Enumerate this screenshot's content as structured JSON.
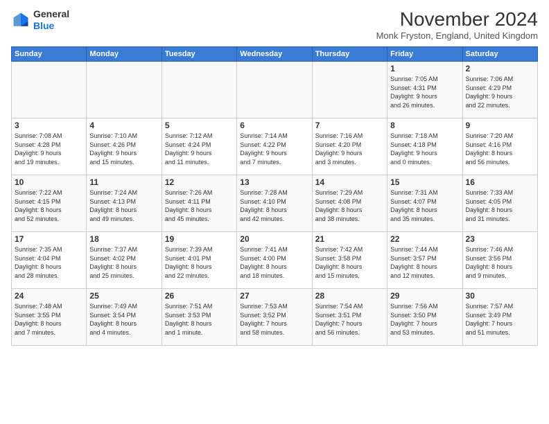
{
  "header": {
    "logo_line1": "General",
    "logo_line2": "Blue",
    "month_title": "November 2024",
    "location": "Monk Fryston, England, United Kingdom"
  },
  "weekdays": [
    "Sunday",
    "Monday",
    "Tuesday",
    "Wednesday",
    "Thursday",
    "Friday",
    "Saturday"
  ],
  "weeks": [
    [
      {
        "day": "",
        "info": ""
      },
      {
        "day": "",
        "info": ""
      },
      {
        "day": "",
        "info": ""
      },
      {
        "day": "",
        "info": ""
      },
      {
        "day": "",
        "info": ""
      },
      {
        "day": "1",
        "info": "Sunrise: 7:05 AM\nSunset: 4:31 PM\nDaylight: 9 hours\nand 26 minutes."
      },
      {
        "day": "2",
        "info": "Sunrise: 7:06 AM\nSunset: 4:29 PM\nDaylight: 9 hours\nand 22 minutes."
      }
    ],
    [
      {
        "day": "3",
        "info": "Sunrise: 7:08 AM\nSunset: 4:28 PM\nDaylight: 9 hours\nand 19 minutes."
      },
      {
        "day": "4",
        "info": "Sunrise: 7:10 AM\nSunset: 4:26 PM\nDaylight: 9 hours\nand 15 minutes."
      },
      {
        "day": "5",
        "info": "Sunrise: 7:12 AM\nSunset: 4:24 PM\nDaylight: 9 hours\nand 11 minutes."
      },
      {
        "day": "6",
        "info": "Sunrise: 7:14 AM\nSunset: 4:22 PM\nDaylight: 9 hours\nand 7 minutes."
      },
      {
        "day": "7",
        "info": "Sunrise: 7:16 AM\nSunset: 4:20 PM\nDaylight: 9 hours\nand 3 minutes."
      },
      {
        "day": "8",
        "info": "Sunrise: 7:18 AM\nSunset: 4:18 PM\nDaylight: 9 hours\nand 0 minutes."
      },
      {
        "day": "9",
        "info": "Sunrise: 7:20 AM\nSunset: 4:16 PM\nDaylight: 8 hours\nand 56 minutes."
      }
    ],
    [
      {
        "day": "10",
        "info": "Sunrise: 7:22 AM\nSunset: 4:15 PM\nDaylight: 8 hours\nand 52 minutes."
      },
      {
        "day": "11",
        "info": "Sunrise: 7:24 AM\nSunset: 4:13 PM\nDaylight: 8 hours\nand 49 minutes."
      },
      {
        "day": "12",
        "info": "Sunrise: 7:26 AM\nSunset: 4:11 PM\nDaylight: 8 hours\nand 45 minutes."
      },
      {
        "day": "13",
        "info": "Sunrise: 7:28 AM\nSunset: 4:10 PM\nDaylight: 8 hours\nand 42 minutes."
      },
      {
        "day": "14",
        "info": "Sunrise: 7:29 AM\nSunset: 4:08 PM\nDaylight: 8 hours\nand 38 minutes."
      },
      {
        "day": "15",
        "info": "Sunrise: 7:31 AM\nSunset: 4:07 PM\nDaylight: 8 hours\nand 35 minutes."
      },
      {
        "day": "16",
        "info": "Sunrise: 7:33 AM\nSunset: 4:05 PM\nDaylight: 8 hours\nand 31 minutes."
      }
    ],
    [
      {
        "day": "17",
        "info": "Sunrise: 7:35 AM\nSunset: 4:04 PM\nDaylight: 8 hours\nand 28 minutes."
      },
      {
        "day": "18",
        "info": "Sunrise: 7:37 AM\nSunset: 4:02 PM\nDaylight: 8 hours\nand 25 minutes."
      },
      {
        "day": "19",
        "info": "Sunrise: 7:39 AM\nSunset: 4:01 PM\nDaylight: 8 hours\nand 22 minutes."
      },
      {
        "day": "20",
        "info": "Sunrise: 7:41 AM\nSunset: 4:00 PM\nDaylight: 8 hours\nand 18 minutes."
      },
      {
        "day": "21",
        "info": "Sunrise: 7:42 AM\nSunset: 3:58 PM\nDaylight: 8 hours\nand 15 minutes."
      },
      {
        "day": "22",
        "info": "Sunrise: 7:44 AM\nSunset: 3:57 PM\nDaylight: 8 hours\nand 12 minutes."
      },
      {
        "day": "23",
        "info": "Sunrise: 7:46 AM\nSunset: 3:56 PM\nDaylight: 8 hours\nand 9 minutes."
      }
    ],
    [
      {
        "day": "24",
        "info": "Sunrise: 7:48 AM\nSunset: 3:55 PM\nDaylight: 8 hours\nand 7 minutes."
      },
      {
        "day": "25",
        "info": "Sunrise: 7:49 AM\nSunset: 3:54 PM\nDaylight: 8 hours\nand 4 minutes."
      },
      {
        "day": "26",
        "info": "Sunrise: 7:51 AM\nSunset: 3:53 PM\nDaylight: 8 hours\nand 1 minute."
      },
      {
        "day": "27",
        "info": "Sunrise: 7:53 AM\nSunset: 3:52 PM\nDaylight: 7 hours\nand 58 minutes."
      },
      {
        "day": "28",
        "info": "Sunrise: 7:54 AM\nSunset: 3:51 PM\nDaylight: 7 hours\nand 56 minutes."
      },
      {
        "day": "29",
        "info": "Sunrise: 7:56 AM\nSunset: 3:50 PM\nDaylight: 7 hours\nand 53 minutes."
      },
      {
        "day": "30",
        "info": "Sunrise: 7:57 AM\nSunset: 3:49 PM\nDaylight: 7 hours\nand 51 minutes."
      }
    ]
  ]
}
